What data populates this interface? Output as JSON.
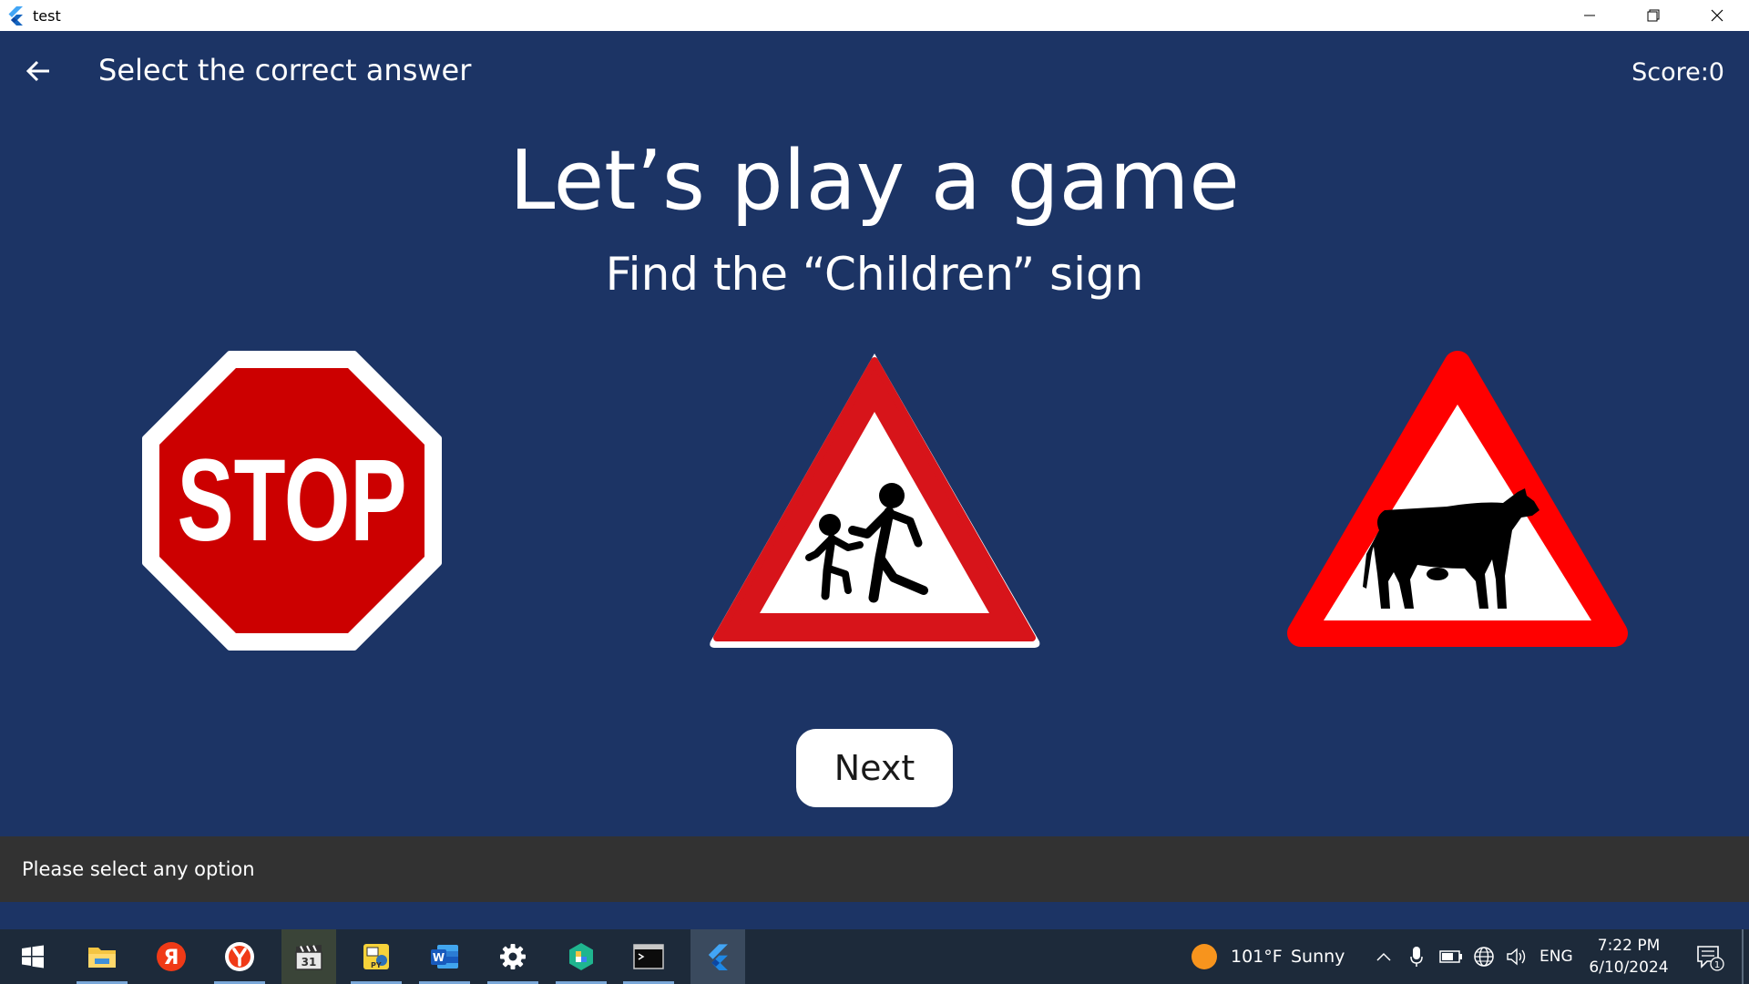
{
  "window": {
    "title": "test"
  },
  "appbar": {
    "title": "Select the correct answer",
    "score": "Score:0"
  },
  "game": {
    "heading": "Let’s play a game",
    "prompt": "Find the “Children” sign",
    "options": [
      {
        "sign": "stop",
        "text": "STOP"
      },
      {
        "sign": "children-crossing"
      },
      {
        "sign": "cattle-crossing"
      }
    ],
    "next_label": "Next"
  },
  "snackbar": {
    "message": "Please select any option"
  },
  "taskbar": {
    "apps": [
      "start-icon",
      "file-explorer-icon",
      "yandex-icon",
      "yandex-browser-icon",
      "media-app-icon",
      "python-app-icon",
      "word-icon",
      "settings-icon",
      "app-icon",
      "terminal-icon",
      "flutter-icon"
    ],
    "weather": {
      "temp": "101°F",
      "condition": "Sunny"
    },
    "language": "ENG",
    "time": "7:22 PM",
    "date": "6/10/2024",
    "notifications": "1"
  },
  "colors": {
    "background": "#1c3465",
    "sign_red": "#cc0000",
    "triangle_red": "#e30613",
    "cow_red": "#ff0000",
    "snackbar": "#323232",
    "taskbar": "#1d2a3a"
  }
}
